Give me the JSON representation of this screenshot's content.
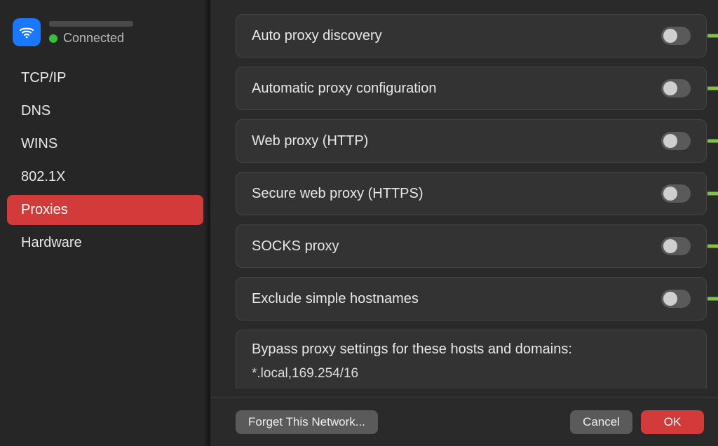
{
  "network": {
    "status_text": "Connected",
    "status_color": "#38c13a",
    "icon": "wifi-icon"
  },
  "sidebar": {
    "items": [
      {
        "label": "TCP/IP",
        "selected": false
      },
      {
        "label": "DNS",
        "selected": false
      },
      {
        "label": "WINS",
        "selected": false
      },
      {
        "label": "802.1X",
        "selected": false
      },
      {
        "label": "Proxies",
        "selected": true
      },
      {
        "label": "Hardware",
        "selected": false
      }
    ]
  },
  "proxies": {
    "rows": [
      {
        "label": "Auto proxy discovery",
        "enabled": false
      },
      {
        "label": "Automatic proxy configuration",
        "enabled": false
      },
      {
        "label": "Web proxy (HTTP)",
        "enabled": false
      },
      {
        "label": "Secure web proxy (HTTPS)",
        "enabled": false
      },
      {
        "label": "SOCKS proxy",
        "enabled": false
      },
      {
        "label": "Exclude simple hostnames",
        "enabled": false
      }
    ],
    "bypass_title": "Bypass proxy settings for these hosts and domains:",
    "bypass_value": "*.local,169.254/16"
  },
  "footer": {
    "forget_label": "Forget This Network...",
    "cancel_label": "Cancel",
    "ok_label": "OK"
  },
  "annotation": {
    "arrow_color": "#82c341",
    "highlight_color": "#82c341"
  }
}
